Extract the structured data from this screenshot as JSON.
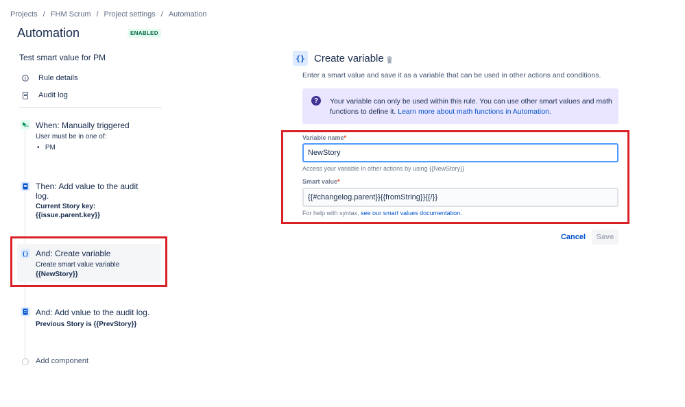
{
  "breadcrumb": [
    "Projects",
    "FHM Scrum",
    "Project settings",
    "Automation"
  ],
  "page": {
    "title": "Automation",
    "status_badge": "ENABLED"
  },
  "rule": {
    "name": "Test smart value for PM"
  },
  "nav": {
    "rule_details": "Rule details",
    "audit_log": "Audit log"
  },
  "steps": {
    "trigger": {
      "title": "When: Manually triggered",
      "sub": "User must be in one of:",
      "bullet": "PM",
      "icon": "manual-trigger-icon"
    },
    "audit1": {
      "title_line1": "Then: Add value to the audit",
      "title_line2": "log.",
      "bold_line1": "Current Story key:",
      "bold_line2": "{{issue.parent.key}}",
      "icon": "audit-log-icon"
    },
    "create_var": {
      "title": "And: Create variable",
      "sub": "Create smart value variable",
      "bold": "{{NewStory}}",
      "icon": "curly-braces-icon"
    },
    "audit2": {
      "title": "And: Add value to the audit log.",
      "bold": "Previous Story is {{PrevStory}}",
      "icon": "audit-log-icon"
    },
    "add_component": "Add component"
  },
  "panel": {
    "icon": "curly-braces-icon",
    "icon_glyph": "{}",
    "title": "Create variable",
    "description": "Enter a smart value and save it as a variable that can be used in other actions and conditions.",
    "info": {
      "icon_glyph": "?",
      "text": "Your variable can only be used within this rule. You can use other smart values and math functions to define it. ",
      "link": "Learn more about math functions in Automation."
    },
    "variable_name": {
      "label": "Variable name",
      "required": "*",
      "value": "NewStory",
      "help": "Access your variable in other actions by using {{NewStory}}"
    },
    "smart_value": {
      "label": "Smart value",
      "required": "*",
      "value": "{{#changelog.parent}}{{fromString}}{{/}}",
      "help": "For help with syntax, ",
      "help_link": "see our smart values documentation."
    },
    "cancel_label": "Cancel",
    "save_label": "Save"
  },
  "colors": {
    "accent": "#0052cc",
    "highlight": "#d92027",
    "info_bg": "#eae6ff",
    "enabled": "#006644"
  }
}
